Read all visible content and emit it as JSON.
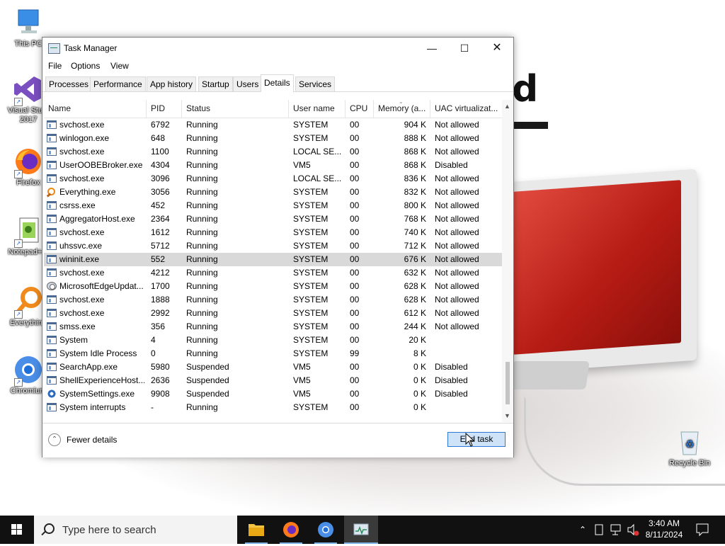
{
  "desktop": {
    "icons": [
      {
        "label": "This PC",
        "icon": "this-pc-icon"
      },
      {
        "label": "Visual Stu...\n2017",
        "icon": "visual-studio-icon"
      },
      {
        "label": "Firefox",
        "icon": "firefox-icon"
      },
      {
        "label": "Notepad+...",
        "icon": "notepadpp-icon"
      },
      {
        "label": "Everything",
        "icon": "everything-icon"
      },
      {
        "label": "Chromium",
        "icon": "chromium-icon"
      },
      {
        "label": "Recycle Bin",
        "icon": "recycle-bin-icon"
      }
    ]
  },
  "window": {
    "title": "Task Manager",
    "menu": [
      "File",
      "Options",
      "View"
    ],
    "tabs": [
      "Processes",
      "Performance",
      "App history",
      "Startup",
      "Users",
      "Details",
      "Services"
    ],
    "active_tab": "Details",
    "columns": [
      "Name",
      "PID",
      "Status",
      "User name",
      "CPU",
      "Memory (a...",
      "UAC virtualizat..."
    ],
    "rows": [
      {
        "name": "svchost.exe",
        "pid": "6792",
        "status": "Running",
        "user": "SYSTEM",
        "cpu": "00",
        "mem": "904 K",
        "uac": "Not allowed",
        "icon": "process-icon"
      },
      {
        "name": "winlogon.exe",
        "pid": "648",
        "status": "Running",
        "user": "SYSTEM",
        "cpu": "00",
        "mem": "888 K",
        "uac": "Not allowed",
        "icon": "process-icon"
      },
      {
        "name": "svchost.exe",
        "pid": "1100",
        "status": "Running",
        "user": "LOCAL SE...",
        "cpu": "00",
        "mem": "868 K",
        "uac": "Not allowed",
        "icon": "process-icon"
      },
      {
        "name": "UserOOBEBroker.exe",
        "pid": "4304",
        "status": "Running",
        "user": "VM5",
        "cpu": "00",
        "mem": "868 K",
        "uac": "Disabled",
        "icon": "process-icon"
      },
      {
        "name": "svchost.exe",
        "pid": "3096",
        "status": "Running",
        "user": "LOCAL SE...",
        "cpu": "00",
        "mem": "836 K",
        "uac": "Not allowed",
        "icon": "process-icon"
      },
      {
        "name": "Everything.exe",
        "pid": "3056",
        "status": "Running",
        "user": "SYSTEM",
        "cpu": "00",
        "mem": "832 K",
        "uac": "Not allowed",
        "icon": "everything-icon"
      },
      {
        "name": "csrss.exe",
        "pid": "452",
        "status": "Running",
        "user": "SYSTEM",
        "cpu": "00",
        "mem": "800 K",
        "uac": "Not allowed",
        "icon": "process-icon"
      },
      {
        "name": "AggregatorHost.exe",
        "pid": "2364",
        "status": "Running",
        "user": "SYSTEM",
        "cpu": "00",
        "mem": "768 K",
        "uac": "Not allowed",
        "icon": "process-icon"
      },
      {
        "name": "svchost.exe",
        "pid": "1612",
        "status": "Running",
        "user": "SYSTEM",
        "cpu": "00",
        "mem": "740 K",
        "uac": "Not allowed",
        "icon": "process-icon"
      },
      {
        "name": "uhssvc.exe",
        "pid": "5712",
        "status": "Running",
        "user": "SYSTEM",
        "cpu": "00",
        "mem": "712 K",
        "uac": "Not allowed",
        "icon": "process-icon"
      },
      {
        "name": "wininit.exe",
        "pid": "552",
        "status": "Running",
        "user": "SYSTEM",
        "cpu": "00",
        "mem": "676 K",
        "uac": "Not allowed",
        "icon": "process-icon",
        "selected": true
      },
      {
        "name": "svchost.exe",
        "pid": "4212",
        "status": "Running",
        "user": "SYSTEM",
        "cpu": "00",
        "mem": "632 K",
        "uac": "Not allowed",
        "icon": "process-icon"
      },
      {
        "name": "MicrosoftEdgeUpdat...",
        "pid": "1700",
        "status": "Running",
        "user": "SYSTEM",
        "cpu": "00",
        "mem": "628 K",
        "uac": "Not allowed",
        "icon": "edge-update-icon"
      },
      {
        "name": "svchost.exe",
        "pid": "1888",
        "status": "Running",
        "user": "SYSTEM",
        "cpu": "00",
        "mem": "628 K",
        "uac": "Not allowed",
        "icon": "process-icon"
      },
      {
        "name": "svchost.exe",
        "pid": "2992",
        "status": "Running",
        "user": "SYSTEM",
        "cpu": "00",
        "mem": "612 K",
        "uac": "Not allowed",
        "icon": "process-icon"
      },
      {
        "name": "smss.exe",
        "pid": "356",
        "status": "Running",
        "user": "SYSTEM",
        "cpu": "00",
        "mem": "244 K",
        "uac": "Not allowed",
        "icon": "process-icon"
      },
      {
        "name": "System",
        "pid": "4",
        "status": "Running",
        "user": "SYSTEM",
        "cpu": "00",
        "mem": "20 K",
        "uac": "",
        "icon": "process-icon"
      },
      {
        "name": "System Idle Process",
        "pid": "0",
        "status": "Running",
        "user": "SYSTEM",
        "cpu": "99",
        "mem": "8 K",
        "uac": "",
        "icon": "process-icon"
      },
      {
        "name": "SearchApp.exe",
        "pid": "5980",
        "status": "Suspended",
        "user": "VM5",
        "cpu": "00",
        "mem": "0 K",
        "uac": "Disabled",
        "icon": "process-icon"
      },
      {
        "name": "ShellExperienceHost....",
        "pid": "2636",
        "status": "Suspended",
        "user": "VM5",
        "cpu": "00",
        "mem": "0 K",
        "uac": "Disabled",
        "icon": "process-icon"
      },
      {
        "name": "SystemSettings.exe",
        "pid": "9908",
        "status": "Suspended",
        "user": "VM5",
        "cpu": "00",
        "mem": "0 K",
        "uac": "Disabled",
        "icon": "settings-gear-icon"
      },
      {
        "name": "System interrupts",
        "pid": "-",
        "status": "Running",
        "user": "SYSTEM",
        "cpu": "00",
        "mem": "0 K",
        "uac": "",
        "icon": "process-icon"
      }
    ],
    "footer": {
      "fewer_details": "Fewer details",
      "end_task": "End task"
    }
  },
  "taskbar": {
    "search_placeholder": "Type here to search",
    "apps": [
      "file-explorer-icon",
      "firefox-icon",
      "chromium-icon",
      "task-manager-icon"
    ],
    "time": "3:40 AM",
    "date": "8/11/2024"
  }
}
